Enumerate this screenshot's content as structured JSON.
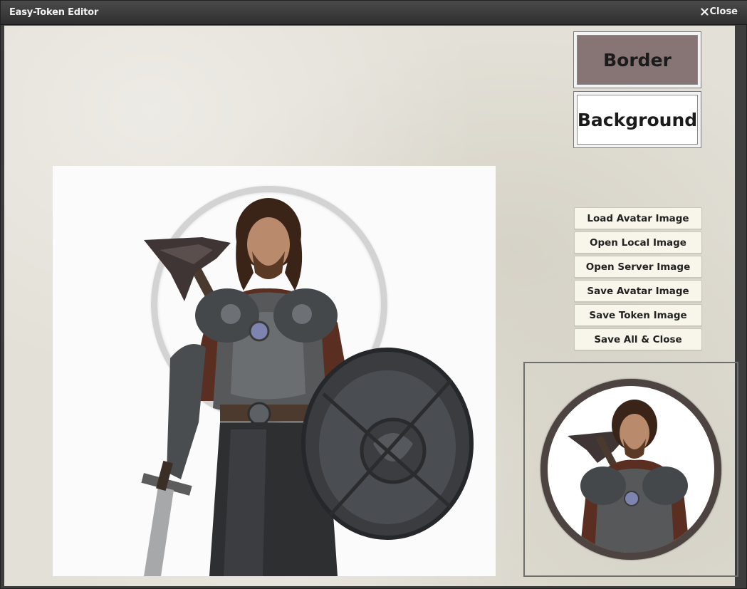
{
  "window": {
    "title": "Easy-Token Editor",
    "close_label": "Close"
  },
  "swatches": {
    "border_label": "Border",
    "border_color": "#867574",
    "background_label": "Background",
    "background_color": "#ffffff"
  },
  "actions": [
    {
      "label": "Load Avatar Image"
    },
    {
      "label": "Open Local Image"
    },
    {
      "label": "Open Server Image"
    },
    {
      "label": "Save Avatar Image"
    },
    {
      "label": "Save Token Image"
    },
    {
      "label": "Save All & Close"
    }
  ],
  "icons": {
    "close": "close-icon",
    "avatar": "armored-warrior-portrait",
    "token": "round-token-preview"
  }
}
